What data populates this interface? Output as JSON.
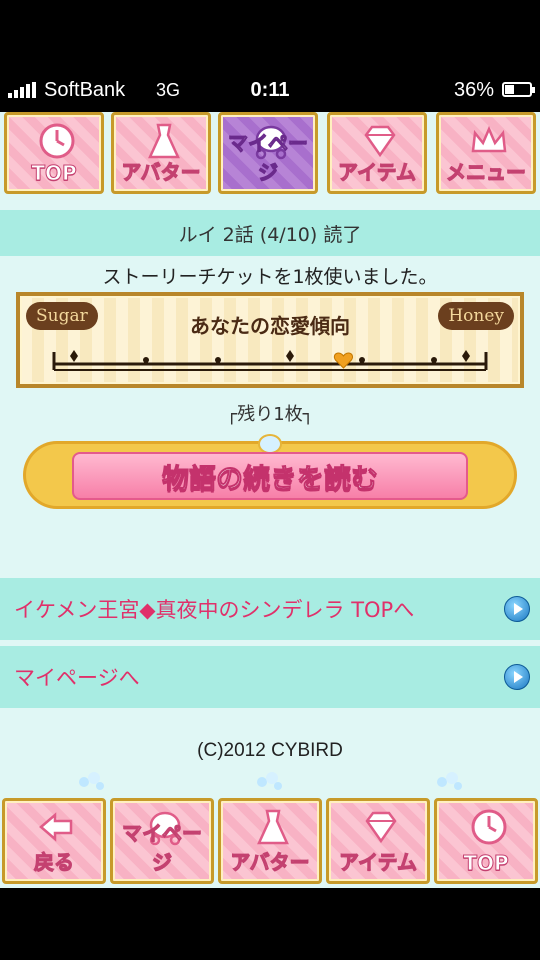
{
  "status_bar": {
    "carrier": "SoftBank",
    "network": "3G",
    "time": "0:11",
    "battery": "36%",
    "battery_level": 0.36
  },
  "top_nav": [
    {
      "label": "TOP",
      "icon": "clock-icon",
      "active": false
    },
    {
      "label": "アバター",
      "icon": "dress-icon",
      "active": false
    },
    {
      "label": "マイページ",
      "icon": "carriage-icon",
      "active": true
    },
    {
      "label": "アイテム",
      "icon": "diamond-icon",
      "active": false
    },
    {
      "label": "メニュー",
      "icon": "crown-icon",
      "active": false
    }
  ],
  "story": {
    "title": "ルイ 2話 (4/10) 読了",
    "notice": "ストーリーチケットを1枚使いました。"
  },
  "love_meter": {
    "left_tag": "Sugar",
    "right_tag": "Honey",
    "title": "あなたの恋愛傾向",
    "heart_position": 0.67
  },
  "tickets": {
    "remaining": "┌残り1枚┐"
  },
  "continue_button": {
    "label": "物語の続きを読む"
  },
  "links": [
    {
      "label": "イケメン王宮◆真夜中のシンデレラ TOPへ"
    },
    {
      "label": "マイページへ"
    }
  ],
  "footer": {
    "copyright": "(C)2012 CYBIRD"
  },
  "bottom_nav": [
    {
      "label": "戻る",
      "icon": "back-arrow-icon"
    },
    {
      "label": "マイページ",
      "icon": "carriage-icon"
    },
    {
      "label": "アバター",
      "icon": "dress-icon"
    },
    {
      "label": "アイテム",
      "icon": "diamond-icon"
    },
    {
      "label": "TOP",
      "icon": "clock-icon"
    }
  ],
  "colors": {
    "background": "#e0f7f5",
    "band": "#a8ece2",
    "link": "#e0306a",
    "tile_pink": "#fbc5d2",
    "tile_purple": "#b784d6",
    "gold": "#c79a2a"
  }
}
